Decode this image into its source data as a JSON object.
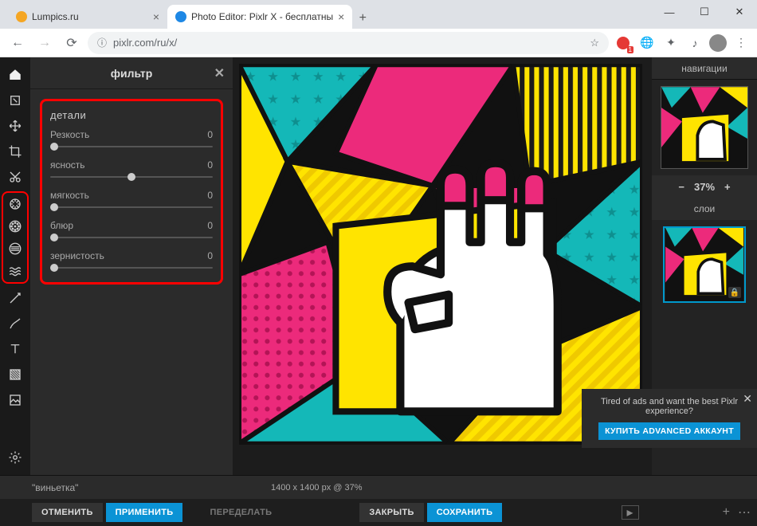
{
  "browser": {
    "tabs": [
      {
        "title": "Lumpics.ru",
        "favicon": "#f5a623",
        "active": false
      },
      {
        "title": "Photo Editor: Pixlr X - бесплатны",
        "favicon": "#1e88e5",
        "active": true
      }
    ],
    "url_display": "pixlr.com/ru/x/",
    "extension_badge": "1"
  },
  "panel": {
    "title": "фильтр",
    "section_title": "детали",
    "sliders": [
      {
        "label": "Резкость",
        "value": "0",
        "pos": "left"
      },
      {
        "label": "ясность",
        "value": "0",
        "pos": "center"
      },
      {
        "label": "мягкость",
        "value": "0",
        "pos": "left"
      },
      {
        "label": "блюр",
        "value": "0",
        "pos": "left"
      },
      {
        "label": "зернистость",
        "value": "0",
        "pos": "left"
      }
    ],
    "vignette_label": "\"виньетка\""
  },
  "nav": {
    "title": "навигации",
    "zoom": "37%",
    "layers_title": "слои"
  },
  "status": {
    "dimensions": "1400 x 1400 px @ 37%"
  },
  "actions": {
    "undo": "ОТМЕНИТЬ",
    "apply": "ПРИМЕНИТЬ",
    "redo": "ПЕРЕДЕЛАТЬ",
    "close": "ЗАКРЫТЬ",
    "save": "СОХРАНИТЬ"
  },
  "popup": {
    "text": "Tired of ads and want the best Pixlr experience?",
    "button": "КУПИТЬ ADVANCED АККАУНТ"
  },
  "tools": [
    "home",
    "resize",
    "arrange",
    "crop",
    "cut",
    "adjust",
    "filter",
    "detail",
    "liquify",
    "heal",
    "draw",
    "text",
    "fill",
    "frame"
  ],
  "colors": {
    "accent": "#0b93d5",
    "highlight": "#f00"
  }
}
